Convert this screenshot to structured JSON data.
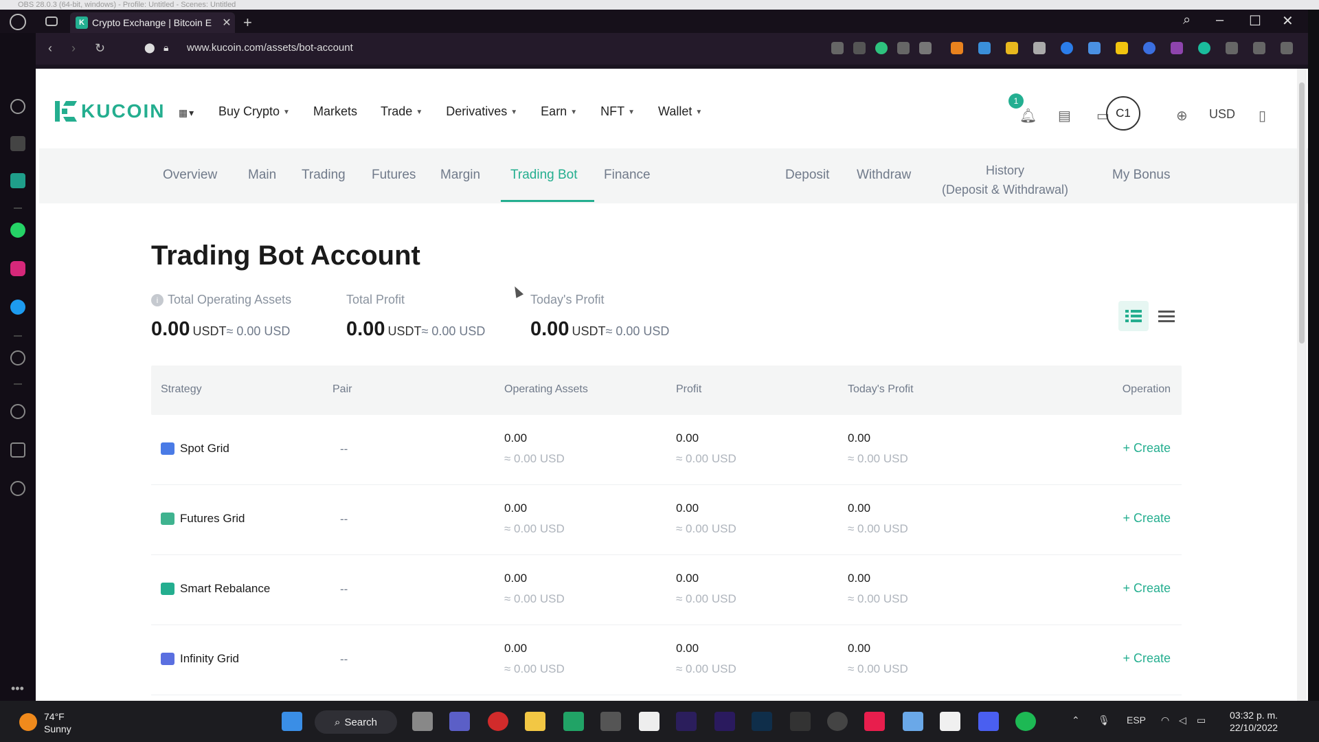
{
  "obs_title": "OBS 28.0.3 (64-bit, windows) - Profile: Untitled - Scenes: Untitled",
  "browser": {
    "tab_title": "Crypto Exchange | Bitcoin E",
    "url": "www.kucoin.com/assets/bot-account"
  },
  "header": {
    "logo_text": "KUCOIN",
    "nav": [
      "Buy Crypto",
      "Markets",
      "Trade",
      "Derivatives",
      "Earn",
      "NFT",
      "Wallet"
    ],
    "nav_has_caret": [
      true,
      false,
      true,
      true,
      true,
      true,
      true
    ],
    "notification_count": "1",
    "avatar_initials": "C1",
    "currency": "USD"
  },
  "subnav": {
    "items": [
      "Overview",
      "Main",
      "Trading",
      "Futures",
      "Margin",
      "Trading Bot",
      "Finance",
      "Deposit",
      "Withdraw"
    ],
    "active": "Trading Bot",
    "history_line1": "History",
    "history_line2": "(Deposit & Withdrawal)",
    "bonus": "My Bonus"
  },
  "page": {
    "title": "Trading Bot Account",
    "stats": [
      {
        "label": "Total Operating Assets",
        "value": "0.00",
        "unit": "USDT",
        "approx": "≈ 0.00 USD"
      },
      {
        "label": "Total Profit",
        "value": "0.00",
        "unit": "USDT",
        "approx": "≈ 0.00 USD"
      },
      {
        "label": "Today's Profit",
        "value": "0.00",
        "unit": "USDT",
        "approx": "≈ 0.00 USD"
      }
    ]
  },
  "table": {
    "headers": [
      "Strategy",
      "Pair",
      "Operating Assets",
      "Profit",
      "Today's Profit",
      "Operation"
    ],
    "rows": [
      {
        "strategy": "Spot Grid",
        "pair": "--",
        "assets": "0.00",
        "assets_usd": "≈ 0.00 USD",
        "profit": "0.00",
        "profit_usd": "≈ 0.00 USD",
        "today": "0.00",
        "today_usd": "≈ 0.00 USD",
        "op": "+ Create"
      },
      {
        "strategy": "Futures Grid",
        "pair": "--",
        "assets": "0.00",
        "assets_usd": "≈ 0.00 USD",
        "profit": "0.00",
        "profit_usd": "≈ 0.00 USD",
        "today": "0.00",
        "today_usd": "≈ 0.00 USD",
        "op": "+ Create"
      },
      {
        "strategy": "Smart Rebalance",
        "pair": "--",
        "assets": "0.00",
        "assets_usd": "≈ 0.00 USD",
        "profit": "0.00",
        "profit_usd": "≈ 0.00 USD",
        "today": "0.00",
        "today_usd": "≈ 0.00 USD",
        "op": "+ Create"
      },
      {
        "strategy": "Infinity Grid",
        "pair": "--",
        "assets": "0.00",
        "assets_usd": "≈ 0.00 USD",
        "profit": "0.00",
        "profit_usd": "≈ 0.00 USD",
        "today": "0.00",
        "today_usd": "≈ 0.00 USD",
        "op": "+ Create"
      }
    ]
  },
  "taskbar": {
    "temp": "74°F",
    "weather": "Sunny",
    "search": "Search",
    "lang": "ESP",
    "time": "03:32 p. m.",
    "date": "22/10/2022"
  },
  "colors": {
    "accent": "#24ae8f",
    "muted": "#707a8a"
  }
}
